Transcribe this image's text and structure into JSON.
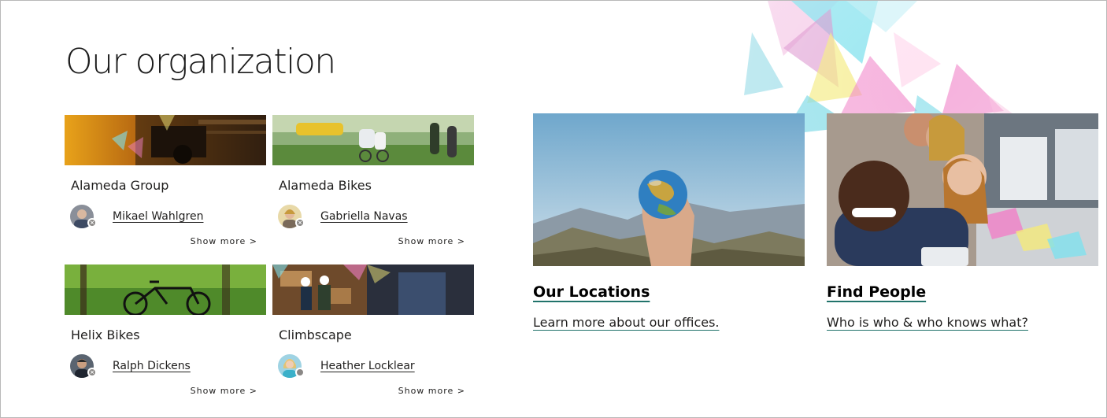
{
  "page": {
    "title": "Our organization"
  },
  "organizations": [
    {
      "name": "Alameda Group",
      "contact": "Mikael Wahlgren",
      "presence": "offline",
      "more": "Show more >"
    },
    {
      "name": "Alameda Bikes",
      "contact": "Gabriella Navas",
      "presence": "offline",
      "more": "Show more >"
    },
    {
      "name": "Helix Bikes",
      "contact": "Ralph Dickens",
      "presence": "offline",
      "more": "Show more >"
    },
    {
      "name": "Climbscape",
      "contact": "Heather Locklear",
      "presence": "unknown",
      "more": "Show more >"
    }
  ],
  "features": [
    {
      "title": "Our Locations",
      "description": "Learn more about our offices."
    },
    {
      "title": "Find People",
      "description": "Who is who & who knows what?"
    }
  ],
  "colors": {
    "link_underline": "#21736b",
    "text": "#201f1e",
    "presence": "#8a8886"
  }
}
